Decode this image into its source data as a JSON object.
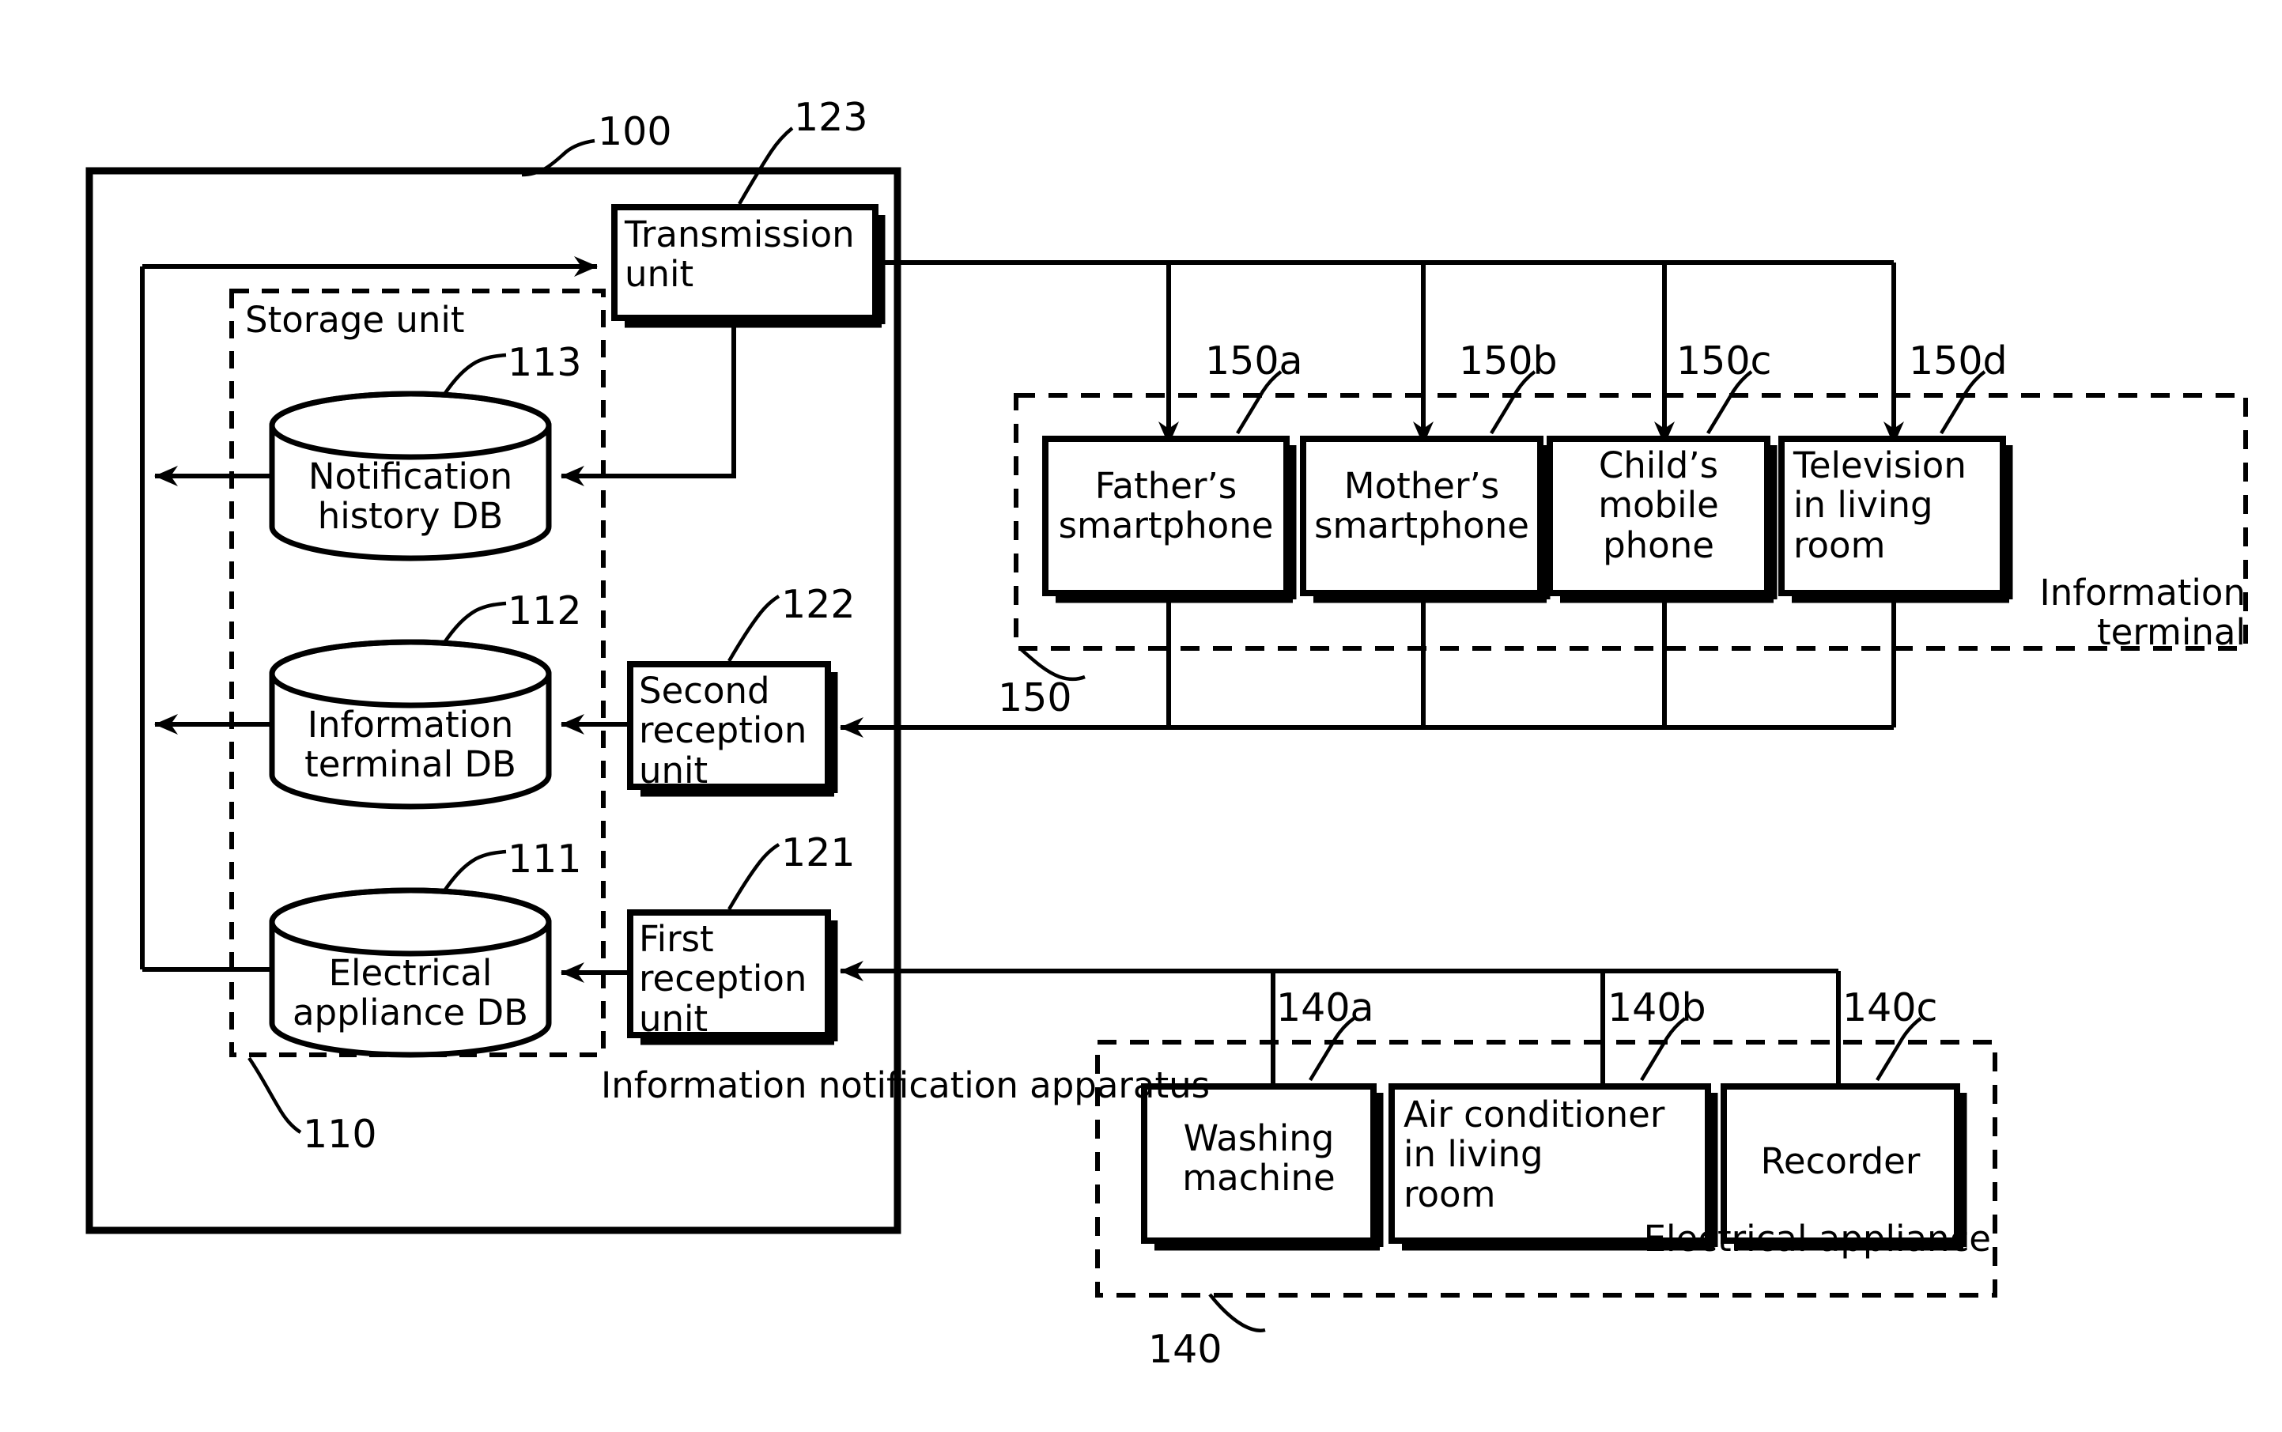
{
  "figure": {
    "kind": "patent-block-diagram",
    "apparatus": {
      "ref": "100",
      "label": "Information notification apparatus",
      "storage_unit": {
        "ref": "110",
        "label": "Storage unit",
        "databases": [
          {
            "ref": "113",
            "label": "Notification\nhistory DB",
            "name": "notification-history-db"
          },
          {
            "ref": "112",
            "label": "Information\nterminal DB",
            "name": "information-terminal-db"
          },
          {
            "ref": "111",
            "label": "Electrical\nappliance DB",
            "name": "electrical-appliance-db"
          }
        ]
      },
      "units": [
        {
          "ref": "123",
          "label": "Transmission\nunit",
          "name": "transmission-unit"
        },
        {
          "ref": "122",
          "label": "Second\nreception\nunit",
          "name": "second-reception-unit"
        },
        {
          "ref": "121",
          "label": "First\nreception\nunit",
          "name": "first-reception-unit"
        }
      ]
    },
    "information_terminal_group": {
      "ref": "150",
      "label": "Information\nterminal",
      "items": [
        {
          "ref": "150a",
          "label": "Father’s\nsmartphone",
          "name": "fathers-smartphone"
        },
        {
          "ref": "150b",
          "label": "Mother’s\nsmartphone",
          "name": "mothers-smartphone"
        },
        {
          "ref": "150c",
          "label": "Child’s\nmobile\nphone",
          "name": "childs-mobile-phone"
        },
        {
          "ref": "150d",
          "label": "Television\nin living\nroom",
          "name": "television-in-living-room"
        }
      ]
    },
    "electrical_appliance_group": {
      "ref": "140",
      "label": "Electrical appliance",
      "items": [
        {
          "ref": "140a",
          "label": "Washing\nmachine",
          "name": "washing-machine"
        },
        {
          "ref": "140b",
          "label": "Air conditioner\nin living\nroom",
          "name": "air-conditioner-in-living-room"
        },
        {
          "ref": "140c",
          "label": "Recorder",
          "name": "recorder"
        }
      ]
    },
    "colors": {
      "stroke": "#000000",
      "background": "#ffffff"
    }
  }
}
